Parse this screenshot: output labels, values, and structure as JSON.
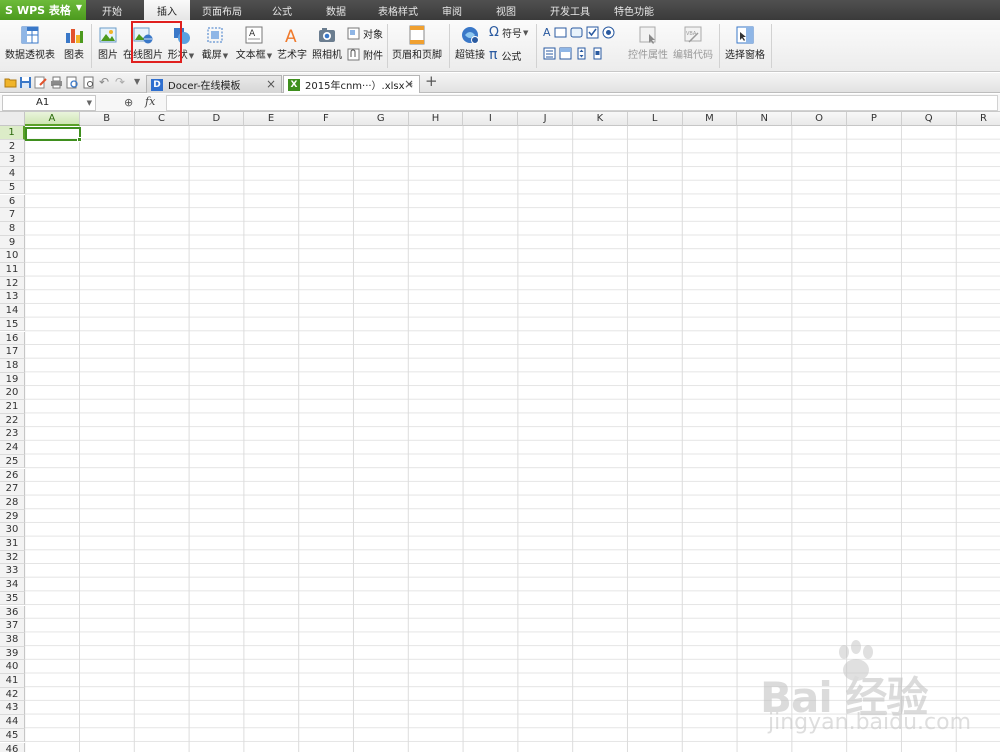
{
  "app": {
    "name": "WPS 表格",
    "logo_glyph": "S"
  },
  "menu": {
    "tabs": [
      {
        "label": "开始",
        "active": false
      },
      {
        "label": "插入",
        "active": true
      },
      {
        "label": "页面布局",
        "active": false
      },
      {
        "label": "公式",
        "active": false
      },
      {
        "label": "数据",
        "active": false
      },
      {
        "label": "表格样式",
        "active": false
      },
      {
        "label": "审阅",
        "active": false
      },
      {
        "label": "视图",
        "active": false
      },
      {
        "label": "开发工具",
        "active": false
      },
      {
        "label": "特色功能",
        "active": false
      }
    ]
  },
  "ribbon": {
    "pivot_table": "数据透视表",
    "chart": "图表",
    "picture": "图片",
    "online_picture": "在线图片",
    "shape": "形状",
    "screenshot": "截屏",
    "textbox": "文本框",
    "wordart": "艺术字",
    "camera": "照相机",
    "object": "对象",
    "attachment": "附件",
    "header_footer": "页眉和页脚",
    "hyperlink": "超链接",
    "symbol": "符号",
    "symbol_glyph": "Ω",
    "formula": "公式",
    "formula_glyph": "π",
    "control_props": "控件属性",
    "edit_code": "编辑代码",
    "selection_pane": "选择窗格",
    "control_glyph_a": "A"
  },
  "doc_tabs": [
    {
      "title": "Docer-在线模板",
      "icon": "D",
      "icon_color": "#2f6fcf"
    },
    {
      "title": "2015年cnm···）.xlsx *",
      "icon": "X",
      "icon_color": "#3f8f1e"
    }
  ],
  "new_tab_glyph": "+",
  "formula_bar": {
    "cell_ref": "A1",
    "fx": "fx",
    "value": ""
  },
  "grid": {
    "columns": [
      "A",
      "B",
      "C",
      "D",
      "E",
      "F",
      "G",
      "H",
      "I",
      "J",
      "K",
      "L",
      "M",
      "N",
      "O",
      "P",
      "Q",
      "R"
    ],
    "rows": [
      "1",
      "2",
      "3",
      "4",
      "5",
      "6",
      "7",
      "8",
      "9",
      "10",
      "11",
      "12",
      "13",
      "14",
      "15",
      "16",
      "17",
      "18",
      "19",
      "20",
      "21",
      "22",
      "23",
      "24",
      "25",
      "26",
      "27",
      "28",
      "29",
      "30",
      "31",
      "32",
      "33",
      "34",
      "35",
      "36",
      "37",
      "38",
      "39",
      "40",
      "41",
      "42",
      "43",
      "44",
      "45",
      "46"
    ],
    "selected_column": "A",
    "selected_row": "1"
  },
  "watermark": {
    "logo": "Bai 经验",
    "url": "jingyan.baidu.com"
  },
  "colors": {
    "accent_green": "#4c9a1e",
    "highlight_red": "#e0201f"
  }
}
